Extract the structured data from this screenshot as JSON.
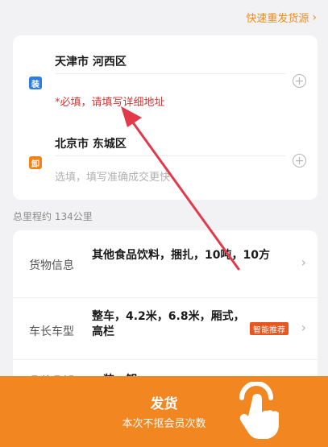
{
  "header": {
    "resend_link": "快速重发货源",
    "chevron_icon": "chevron-right-icon"
  },
  "loading": {
    "badge": "装",
    "city": "天津市 河西区",
    "hint": "*必填，请填写详细地址"
  },
  "unloading": {
    "badge": "卸",
    "city": "北京市 东城区",
    "hint": "选填，填写准确成交更快"
  },
  "distance": "总里程约 134公里",
  "info_rows": [
    {
      "label": "货物信息",
      "value": "其他食品饮料，捆扎，10吨，10方"
    },
    {
      "label": "车长车型",
      "value": "整车，4.2米，6.8米，厢式，高栏",
      "tag": "智能推荐"
    },
    {
      "label": "几装几卸",
      "value": "一装一卸"
    }
  ],
  "bottom": {
    "title": "发货",
    "subtitle": "本次不抠会员次数"
  },
  "colors": {
    "accent": "#f28621",
    "required_text": "#d63636",
    "load_badge": "#2f7de1",
    "unload_badge": "#f2831a",
    "annotation_arrow": "#e23a4a"
  },
  "icons": [
    "plus-circle-icon",
    "chevron-right-icon",
    "tap-hand-icon"
  ]
}
